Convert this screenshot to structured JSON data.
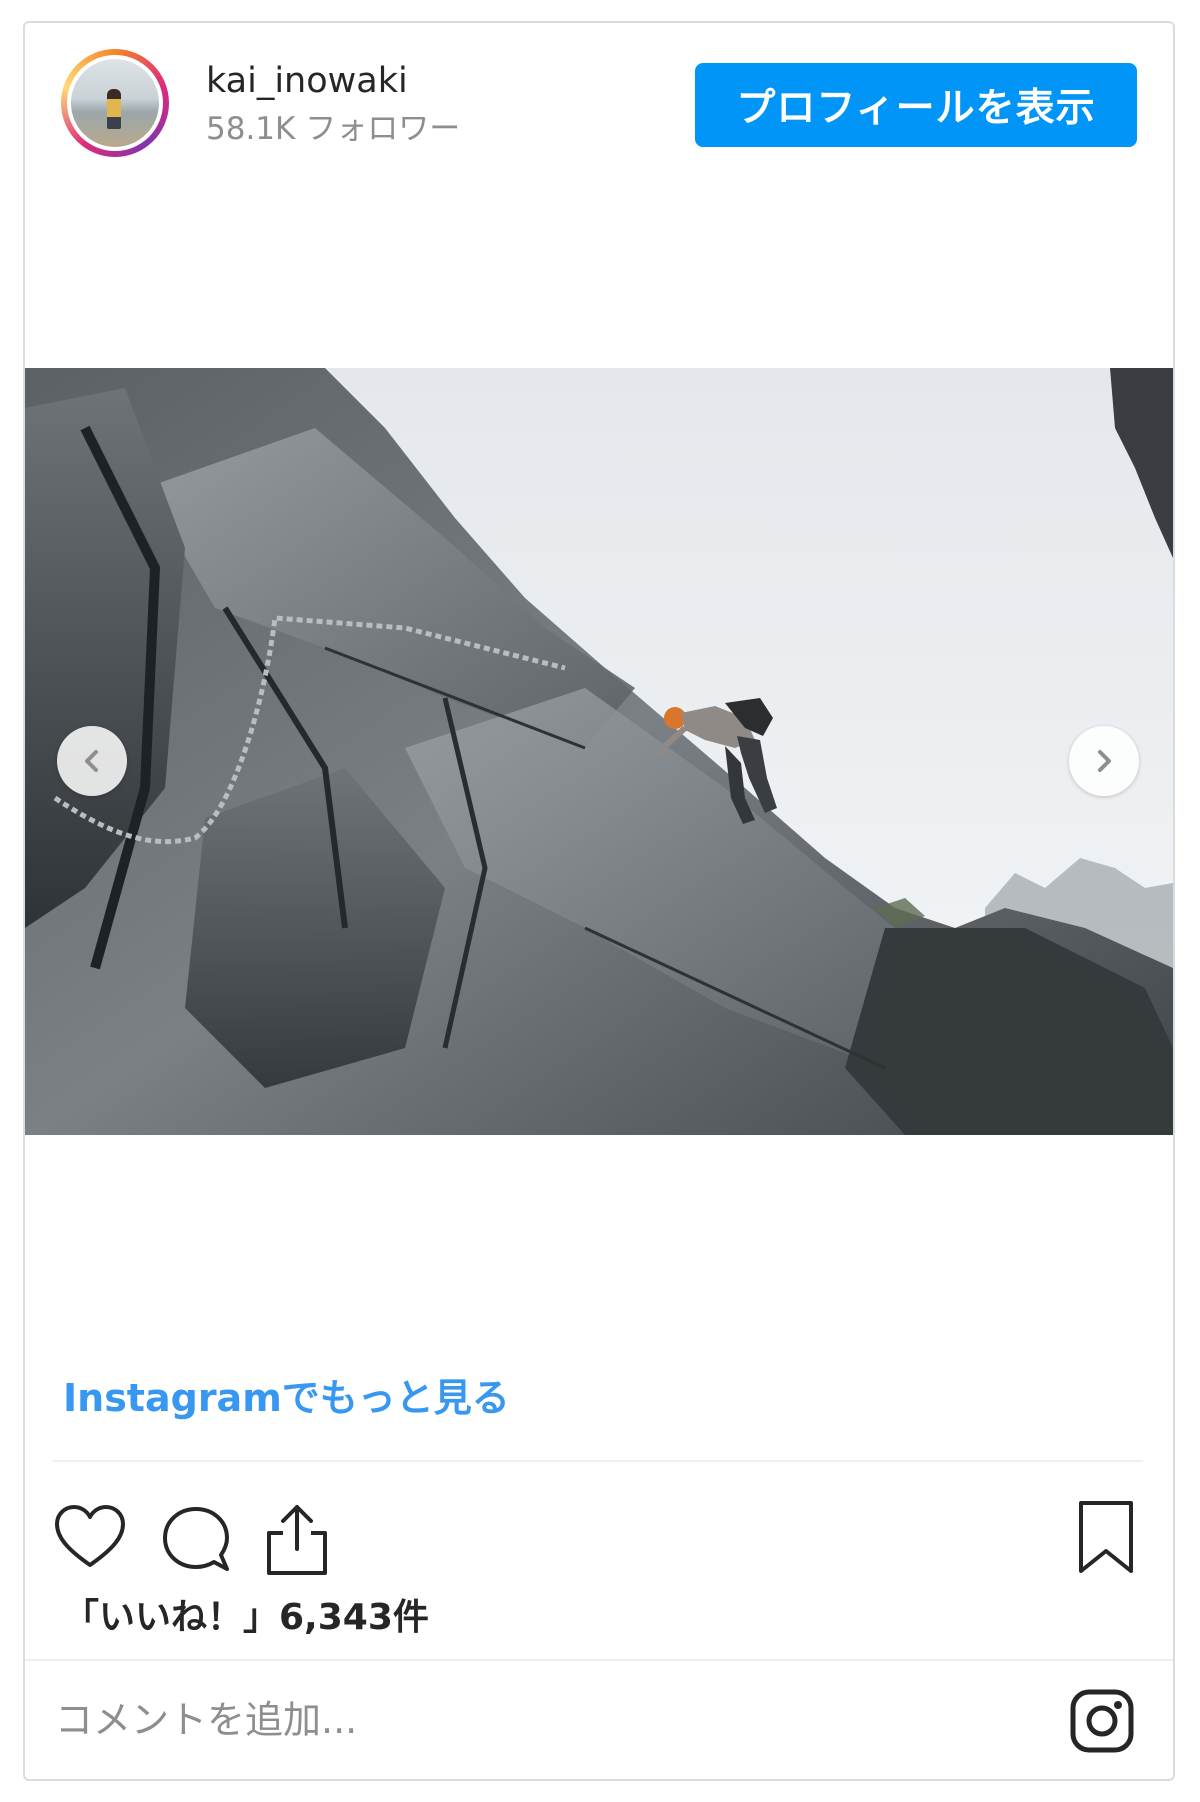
{
  "post": {
    "username": "kai_inowaki",
    "followers": "58.1K フォロワー",
    "profile_button": "プロフィールを表示",
    "more_link": "Instagramでもっと見る",
    "likes": "「いいね！」6,343件",
    "comment_placeholder": "コメントを追加..."
  },
  "icons": {
    "avatar": "profile-photo",
    "prev": "chevron-left-icon",
    "next": "chevron-right-icon",
    "like": "heart-icon",
    "comment": "comment-bubble-icon",
    "share": "share-icon",
    "save": "bookmark-icon",
    "brand": "instagram-icon"
  },
  "colors": {
    "accent": "#0095f6",
    "link": "#3897f0",
    "text": "#262626",
    "muted": "#8e8e8e"
  }
}
